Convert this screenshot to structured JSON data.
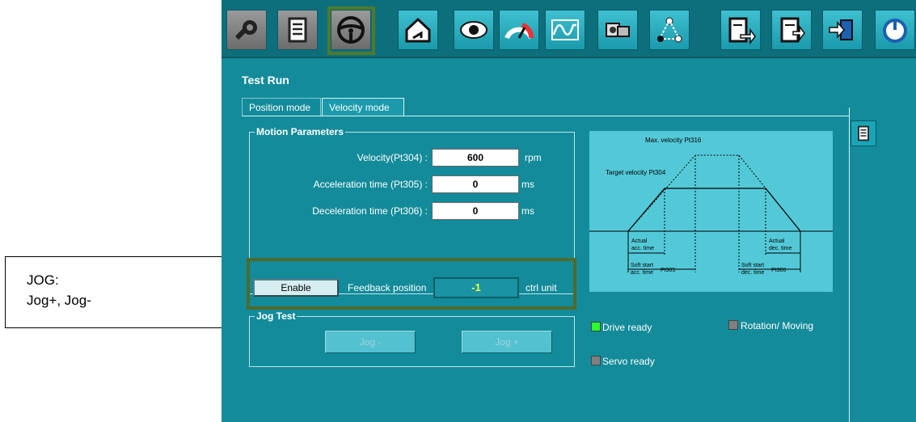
{
  "callout": {
    "line1": "JOG:",
    "line2": "Jog+, Jog-"
  },
  "toolbar": {
    "items": [
      "settings",
      "parameter-list",
      "test-run",
      "home",
      "monitor",
      "dashboard",
      "waveform",
      "servo-drive",
      "motion-path",
      "import",
      "export",
      "download",
      "restart"
    ],
    "selected": "test-run"
  },
  "page": {
    "title": "Test Run"
  },
  "tabs": [
    {
      "label": "Position mode"
    },
    {
      "label": "Velocity mode"
    }
  ],
  "motion": {
    "legend": "Motion Parameters",
    "velocity": {
      "label": "Velocity(Pt304) :",
      "value": "600",
      "unit": "rpm"
    },
    "acceleration": {
      "label": "Acceleration time (Pt305) :",
      "value": "0",
      "unit": "ms"
    },
    "deceleration": {
      "label": "Deceleration time (Pt306) :",
      "value": "0",
      "unit": "ms"
    }
  },
  "enable": {
    "button_label": "Enable",
    "feedback_label": "Feedback position",
    "feedback_value": "-1",
    "feedback_unit": "ctrl unit"
  },
  "jog": {
    "legend": "Jog Test",
    "minus_label": "Jog -",
    "plus_label": "Jog +"
  },
  "diagram": {
    "max_velocity": "Max. velocity",
    "max_velocity_pt": "Pt316",
    "target_velocity": "Target velocity",
    "target_velocity_pt": "Pt304",
    "actual_acc_1": "Actual",
    "actual_acc_2": "acc. time",
    "actual_dec_1": "Actual",
    "actual_dec_2": "dec. time",
    "soft_start_acc_1": "Soft start",
    "soft_start_acc_2": "acc. time",
    "soft_start_acc_pt": "Pt305",
    "soft_start_dec_1": "Soft start",
    "soft_start_dec_2": "dec. time",
    "soft_start_dec_pt": "Pt306"
  },
  "status": {
    "drive_ready": {
      "label": "Drive ready",
      "color": "#2bff2b"
    },
    "servo_ready": {
      "label": "Servo ready",
      "color": "#808080"
    },
    "rotation_moving": {
      "label": "Rotation/ Moving",
      "color": "#808080"
    }
  },
  "colors": {
    "panel": "#138b9a",
    "highlight_border": "#4e6b2c",
    "feedback_text": "#f3ff40"
  }
}
